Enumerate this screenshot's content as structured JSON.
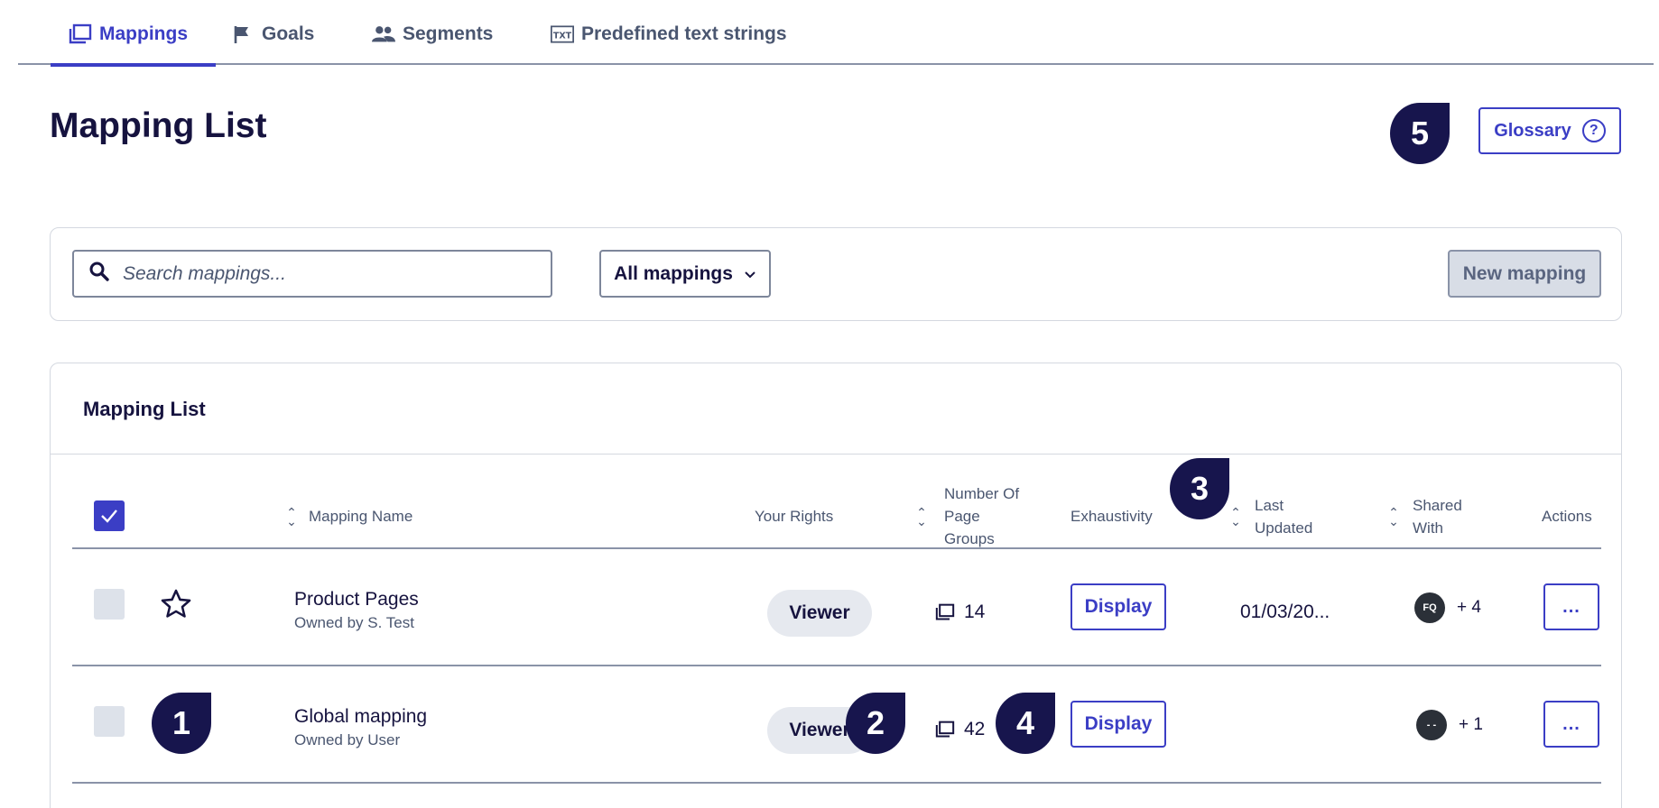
{
  "tabs": [
    {
      "label": "Mappings",
      "icon": "mappings-icon"
    },
    {
      "label": "Goals",
      "icon": "flag-icon"
    },
    {
      "label": "Segments",
      "icon": "people-icon"
    },
    {
      "label": "Predefined text strings",
      "icon": "txt-icon"
    }
  ],
  "active_tab": "Mappings",
  "page_title": "Mapping List",
  "glossary_label": "Glossary",
  "search": {
    "placeholder": "Search mappings..."
  },
  "filter_label": "All mappings",
  "new_mapping_label": "New mapping",
  "list_title": "Mapping List",
  "columns": {
    "name": "Mapping Name",
    "rights": "Your Rights",
    "page_groups": [
      "Number Of",
      "Page",
      "Groups"
    ],
    "exhaustivity": "Exhaustivity",
    "last_updated": [
      "Last",
      "Updated"
    ],
    "shared_with": [
      "Shared",
      "With"
    ],
    "actions": "Actions"
  },
  "rows": [
    {
      "name": "Product Pages",
      "owner": "Owned by S. Test",
      "rights": "Viewer",
      "page_groups": "14",
      "display_label": "Display",
      "last_updated": "01/03/20...",
      "avatar": "FQ",
      "shared_extra": "+ 4",
      "more_label": "..."
    },
    {
      "name": "Global mapping",
      "owner": "Owned by User",
      "rights": "Viewer",
      "page_groups": "42",
      "display_label": "Display",
      "last_updated": "",
      "avatar": "- -",
      "shared_extra": "+ 1",
      "more_label": "..."
    }
  ],
  "markers": [
    "1",
    "2",
    "3",
    "4",
    "5"
  ],
  "colors": {
    "accent": "#3b3ec5",
    "marker": "#17154d",
    "title": "#16133f"
  }
}
